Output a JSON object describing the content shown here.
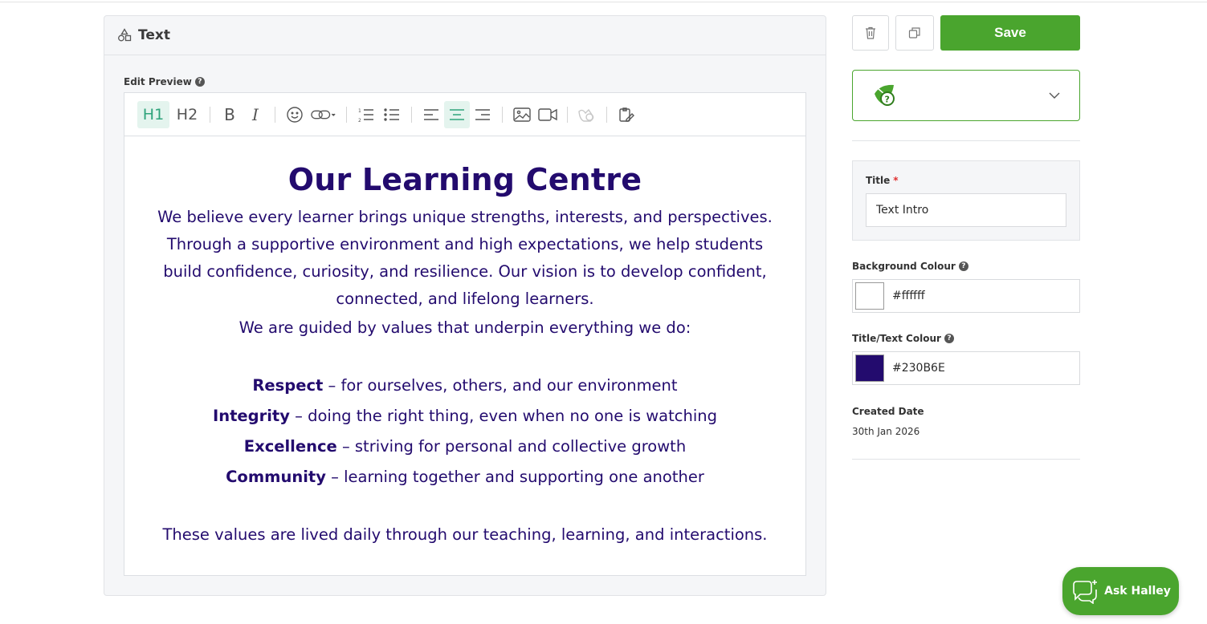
{
  "block": {
    "header_title": "Text",
    "edit_preview_label": "Edit Preview",
    "help_mark": "?"
  },
  "toolbar": {
    "h1": "H1",
    "h2": "H2",
    "bold": "B",
    "italic": "I"
  },
  "content": {
    "heading": "Our Learning Centre",
    "intro": "We believe every learner brings unique strengths, interests, and perspectives. Through a supportive environment and high expectations, we help students build confidence, curiosity, and resilience. Our vision is to develop confident, connected, and lifelong learners.",
    "guided": "We are guided by values that underpin everything we do:",
    "values": [
      {
        "name": "Respect",
        "desc": " – for ourselves, others, and our environment"
      },
      {
        "name": "Integrity",
        "desc": " – doing the right thing, even when no one is watching"
      },
      {
        "name": "Excellence",
        "desc": " – striving for personal and collective growth"
      },
      {
        "name": "Community",
        "desc": " – learning together and supporting one another"
      }
    ],
    "closing": "These values are lived daily through our teaching, learning, and interactions.",
    "text_color": "#230B6E"
  },
  "sidebar": {
    "save_label": "Save",
    "title_label": "Title",
    "required_mark": "*",
    "title_value": "Text Intro",
    "bg_colour_label": "Background Colour",
    "bg_colour_value": "#ffffff",
    "text_colour_label": "Title/Text Colour",
    "text_colour_value": "#230B6E",
    "created_label": "Created Date",
    "created_value": "30th Jan 2026"
  },
  "assistant": {
    "label": "Ask Halley"
  },
  "colors": {
    "brand_green": "#4aa52e",
    "active_tool": "#2fa37b"
  }
}
